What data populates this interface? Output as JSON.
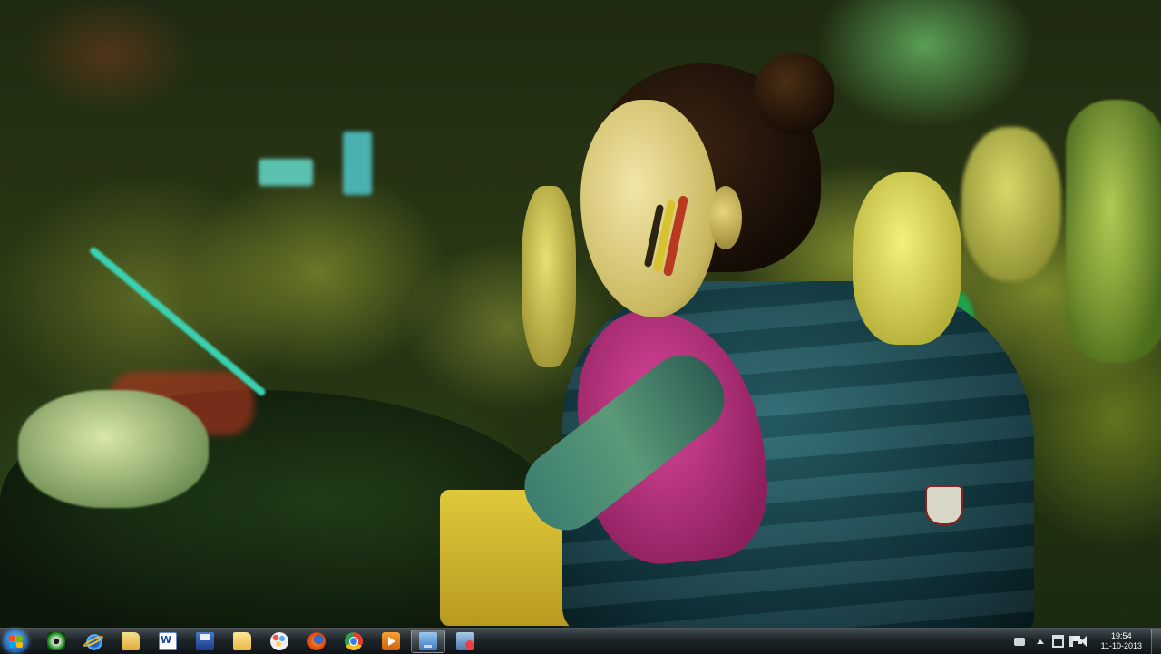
{
  "desktop": {
    "wallpaper": "crowd-photo"
  },
  "taskbar": {
    "pinned": [
      {
        "name": "eye-app-icon"
      },
      {
        "name": "internet-explorer-icon"
      },
      {
        "name": "libraries-folder-icon"
      },
      {
        "name": "word-document-icon"
      },
      {
        "name": "floppy-save-icon"
      },
      {
        "name": "folder-icon"
      },
      {
        "name": "paint-icon"
      },
      {
        "name": "firefox-icon"
      },
      {
        "name": "chrome-icon"
      },
      {
        "name": "media-player-icon"
      },
      {
        "name": "desktop-window-icon"
      },
      {
        "name": "remote-desktop-icon"
      }
    ],
    "active_index": 10
  },
  "tray": {
    "time": "19:54",
    "date": "11-10-2013"
  },
  "colors": {
    "start_orb": "#1d5fa8",
    "taskbar": "#1e2428"
  }
}
